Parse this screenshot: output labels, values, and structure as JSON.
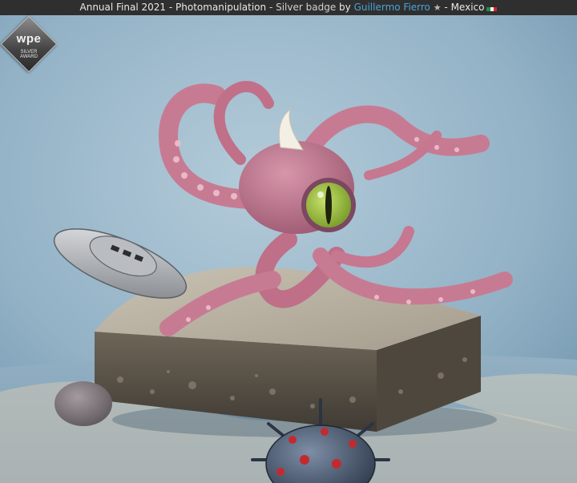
{
  "header": {
    "competition": "Annual Final 2021",
    "separator1": " - ",
    "category": "Photomanipulation",
    "separator2": " - ",
    "award": "Silver badge",
    "by": " by ",
    "author": "Guillermo Fierro",
    "star_icon": "star-icon",
    "separator3": " - ",
    "country": "Mexico",
    "flag_icon": "mexico-flag-icon"
  },
  "badge": {
    "logo_text": "wpe",
    "award_text_line1": "SILVER",
    "award_text_line2": "AWARD"
  },
  "colors": {
    "header_bg": "#2f2f2f",
    "author_link": "#4aa3d8",
    "background": "#8eb0c6",
    "octopus": "#c77b93"
  }
}
